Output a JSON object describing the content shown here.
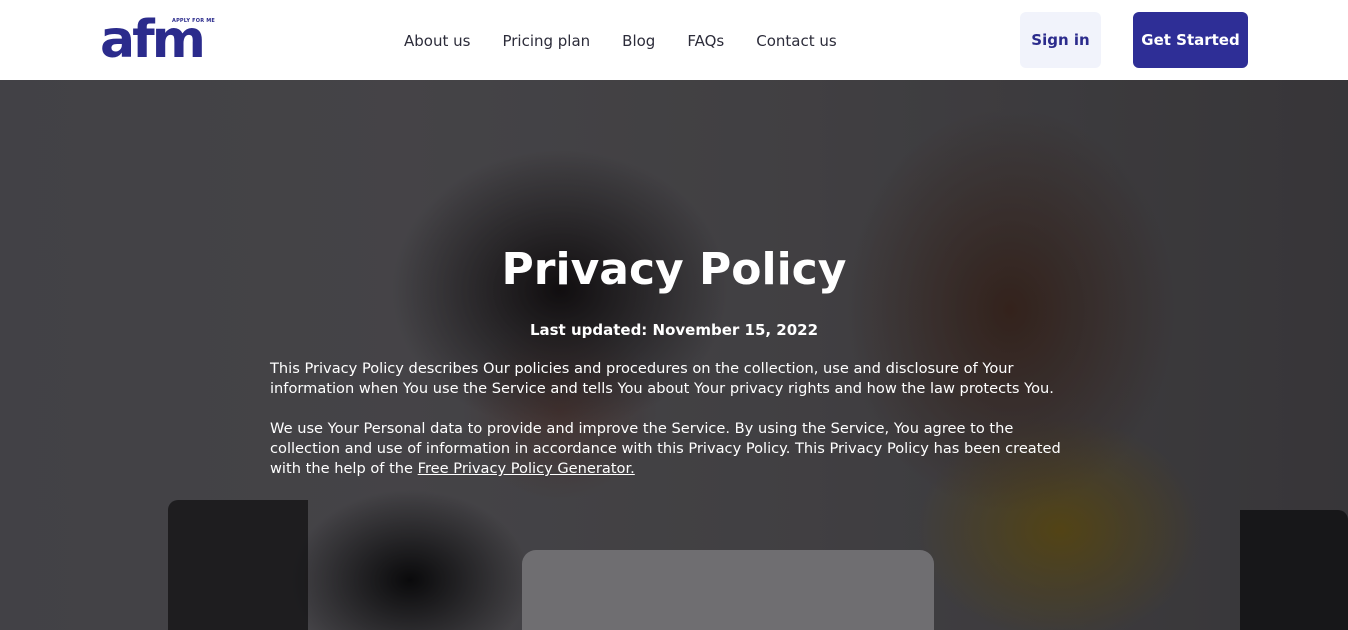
{
  "brand": {
    "logo_text": "afm",
    "logo_tagline": "APPLY FOR ME",
    "primary_color": "#2e2e96"
  },
  "nav": {
    "items": [
      {
        "label": "About us"
      },
      {
        "label": "Pricing plan"
      },
      {
        "label": "Blog"
      },
      {
        "label": "FAQs"
      },
      {
        "label": "Contact us"
      }
    ]
  },
  "header_actions": {
    "sign_in_label": "Sign in",
    "get_started_label": "Get Started"
  },
  "hero": {
    "title": "Privacy Policy",
    "last_updated": "Last updated: November 15, 2022",
    "paragraph1": "This Privacy Policy describes Our policies and procedures on the collection, use and disclosure of Your information when You use the Service and tells You about Your privacy rights and how the law protects You.",
    "paragraph2_text": "We use Your Personal data to provide and improve the Service. By using the Service, You agree to the collection and use of information in accordance with this Privacy Policy. This Privacy Policy has been created with the help of the ",
    "paragraph2_link": "Free Privacy Policy Generator."
  }
}
